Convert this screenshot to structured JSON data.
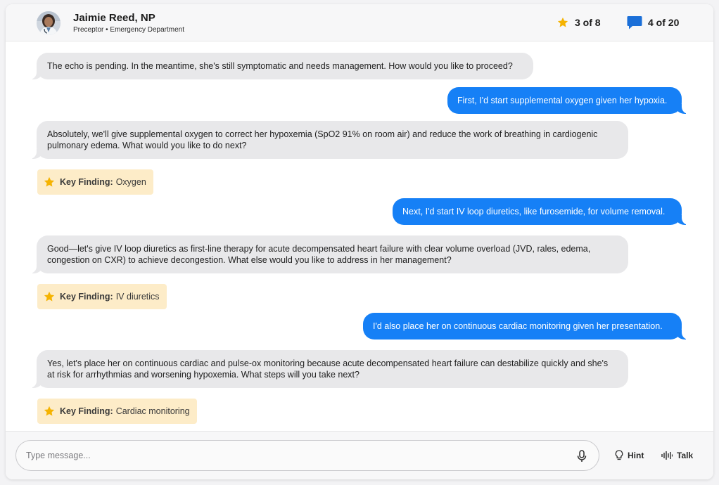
{
  "header": {
    "name": "Jaimie Reed, NP",
    "subtitle": "Preceptor • Emergency Department",
    "stars": "3 of 8",
    "cases": "4 of 20"
  },
  "messages": [
    {
      "role": "ai",
      "text": "The echo is pending. In the meantime, she's still symptomatic and needs management. How would you like to proceed?"
    },
    {
      "role": "user",
      "text": "First, I'd start supplemental oxygen given her hypoxia."
    },
    {
      "role": "ai",
      "text": "Absolutely, we'll give supplemental oxygen to correct her hypoxemia (SpO2 91% on room air) and reduce the work of breathing in cardiogenic pulmonary edema. What would you like to do next?"
    },
    {
      "role": "key",
      "label": "Key Finding:",
      "value": "Oxygen"
    },
    {
      "role": "user",
      "text": "Next, I'd start IV loop diuretics, like furosemide, for volume removal."
    },
    {
      "role": "ai",
      "text": "Good—let's give IV loop diuretics as first-line therapy for acute decompensated heart failure with clear volume overload (JVD, rales, edema, congestion on CXR) to achieve decongestion. What else would you like to address in her management?"
    },
    {
      "role": "key",
      "label": "Key Finding:",
      "value": "IV diuretics"
    },
    {
      "role": "user",
      "text": "I'd also place her on continuous cardiac monitoring given her presentation."
    },
    {
      "role": "ai",
      "text": "Yes, let's place her on continuous cardiac and pulse-ox monitoring because acute decompensated heart failure can destabilize quickly and she's at risk for arrhythmias and worsening hypoxemia. What steps will you take next?"
    },
    {
      "role": "key",
      "label": "Key Finding:",
      "value": "Cardiac monitoring"
    }
  ],
  "composer": {
    "placeholder": "Type message...",
    "hint_label": "Hint",
    "talk_label": "Talk"
  },
  "colors": {
    "accent": "#1680f6",
    "star": "#f5b301",
    "key_bg": "#fdecc8",
    "ai_bubble": "#e8e8ea"
  },
  "icons": [
    "avatar",
    "star-icon",
    "chat-bubble-icon",
    "microphone-icon",
    "lightbulb-icon",
    "waveform-icon"
  ]
}
